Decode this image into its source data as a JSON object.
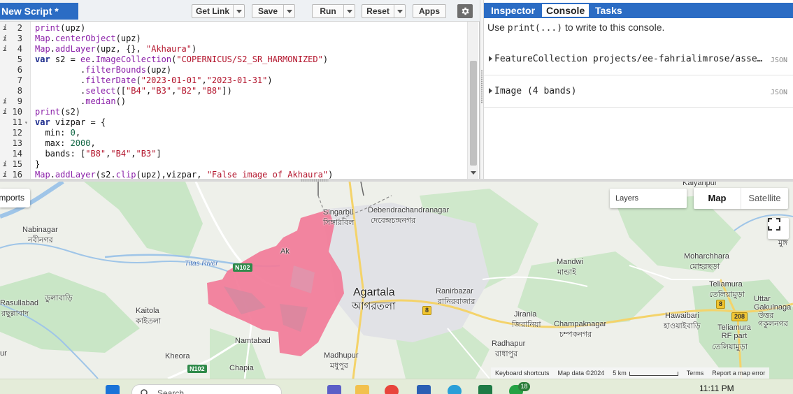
{
  "editor": {
    "script_title": "New Script *",
    "toolbar": {
      "get_link": "Get Link",
      "save": "Save",
      "run": "Run",
      "reset": "Reset",
      "apps": "Apps"
    },
    "lines": [
      {
        "n": "2",
        "mark": "i",
        "fold": "",
        "text": "print(upz)"
      },
      {
        "n": "3",
        "mark": "i",
        "fold": "",
        "text": "Map.centerObject(upz)"
      },
      {
        "n": "4",
        "mark": "i",
        "fold": "",
        "text": "Map.addLayer(upz, {}, \"Akhaura\")"
      },
      {
        "n": "5",
        "mark": "",
        "fold": "",
        "text": "var s2 = ee.ImageCollection(\"COPERNICUS/S2_SR_HARMONIZED\")"
      },
      {
        "n": "6",
        "mark": "",
        "fold": "",
        "text": "         .filterBounds(upz)"
      },
      {
        "n": "7",
        "mark": "",
        "fold": "",
        "text": "         .filterDate(\"2023-01-01\",\"2023-01-31\")"
      },
      {
        "n": "8",
        "mark": "",
        "fold": "",
        "text": "         .select([\"B4\",\"B3\",\"B2\",\"B8\"])"
      },
      {
        "n": "9",
        "mark": "i",
        "fold": "",
        "text": "         .median()"
      },
      {
        "n": "10",
        "mark": "i",
        "fold": "",
        "text": "print(s2)"
      },
      {
        "n": "11",
        "mark": "",
        "fold": "▾",
        "text": "var vizpar = {"
      },
      {
        "n": "12",
        "mark": "",
        "fold": "",
        "text": "  min: 0,"
      },
      {
        "n": "13",
        "mark": "",
        "fold": "",
        "text": "  max: 2000,"
      },
      {
        "n": "14",
        "mark": "",
        "fold": "",
        "text": "  bands: [\"B8\",\"B4\",\"B3\"]"
      },
      {
        "n": "15",
        "mark": "i",
        "fold": "",
        "text": "}"
      },
      {
        "n": "16",
        "mark": "i",
        "fold": "",
        "text": "Map.addLayer(s2.clip(upz),vizpar, \"False image of Akhaura\")"
      }
    ]
  },
  "right_panel": {
    "tabs": [
      "Inspector",
      "Console",
      "Tasks"
    ],
    "active_tab": "Console",
    "hint_prefix": "Use ",
    "hint_code": "print(...)",
    "hint_suffix": " to write to this console.",
    "rows": [
      {
        "text": "FeatureCollection projects/ee-fahrialimrose/asse…",
        "tag": "JSON"
      },
      {
        "text": "Image (4 bands)",
        "tag": "JSON"
      }
    ]
  },
  "map": {
    "imports_tab": "Imports",
    "layers_label": "Layers",
    "map_type_map": "Map",
    "map_type_satellite": "Satellite",
    "labels": {
      "nabinagar_en": "Nabinagar",
      "nabinagar_bn": "নবীনগর",
      "titas_river": "Titas River",
      "rasullabad_en": "Rasullabad",
      "rasullabad_bn": "রছুল্লাবাদ",
      "dulabari_bn": "ডুলাবাড়ি",
      "kaitola_en": "Kaitola",
      "kaitola_bn": "কাইতলা",
      "namtabad": "Namtabad",
      "kheora": "Kheora",
      "chapia": "Chapia",
      "singarbil_en": "Singarbil",
      "singarbil_bn": "সিঙ্গারবিল",
      "ak_partial": "Ak",
      "debendra_en": "Debendrachandranagar",
      "debendra_bn": "দেবেন্দ্রচন্দ্রনগর",
      "agartala_en": "Agartala",
      "agartala_bn": "আগরতলা",
      "ranirbazar_en": "Ranirbazar",
      "ranirbazar_bn": "রানিরবাজার",
      "jirania_en": "Jirania",
      "jirania_bn": "জিরানিয়া",
      "champaknagar_en": "Champaknagar",
      "champaknagar_bn": "চম্পকনগর",
      "radhapur_en": "Radhapur",
      "radhapur_bn": "রাধাপুর",
      "madhupur_en": "Madhupur",
      "madhupur_bn": "মধুপুর",
      "mandwi_en": "Mandwi",
      "mandwi_bn": "মান্ডাই",
      "moharchhara_en": "Moharchhara",
      "moharchhara_bn": "মোহরছড়া",
      "teliamura_en": "Teliamura",
      "teliamura_bn": "তেলিয়ামুড়া",
      "hawaibari_en": "Hawaibari",
      "hawaibari_bn": "হাওয়াইবাড়ি",
      "teliamura_rf_en": "Teliamura RF part",
      "teliamura_rf_bn": "তেলিয়ামুড়া",
      "uttar_gakulnagar_en": "Uttar Gakulnaga",
      "uttar_gakulnagar_bn": "উত্তর গকুলনগর",
      "kalyanpur": "Kalyanpur",
      "mung_partial": "মুঙ্গ",
      "ur_partial": "ur"
    },
    "shields": {
      "n102_top": "N102",
      "n102_bottom": "N102",
      "nh8_a": "8",
      "nh8_b": "8",
      "nh208": "208"
    },
    "attribution": {
      "shortcuts": "Keyboard shortcuts",
      "data": "Map data ©2024",
      "scale": "5 km",
      "terms": "Terms",
      "report": "Report a map error"
    },
    "colors": {
      "land": "#eef0ea",
      "green": "#c7e4c4",
      "water": "#9fc5e8",
      "overlay": "#f27b98",
      "urban": "#e3e3e6"
    }
  },
  "taskbar": {
    "search_placeholder": "Search",
    "badge_count": "18",
    "clock": "11:11 PM"
  }
}
